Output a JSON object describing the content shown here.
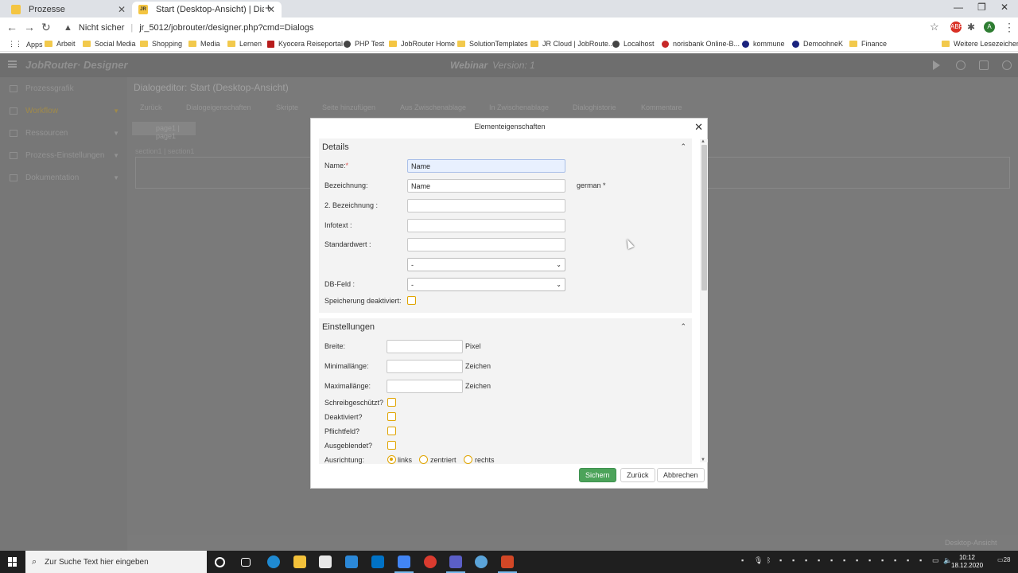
{
  "browser": {
    "tabs": [
      {
        "title": "Prozesse"
      },
      {
        "title": "Start (Desktop-Ansicht) | Dialoge"
      }
    ],
    "security_label": "Nicht sicher",
    "url": "jr_5012/jobrouter/designer.php?cmd=Dialogs",
    "bookmarks": [
      "Apps",
      "Arbeit",
      "Social Media",
      "Shopping",
      "Media",
      "Lernen",
      "Kyocera Reiseportal",
      "PHP Test",
      "JobRouter Home",
      "SolutionTemplates",
      "JR Cloud | JobRoute...",
      "Localhost",
      "norisbank Online-B...",
      "kommune",
      "DemoohneK",
      "Finance"
    ],
    "other_bookmarks": "Weitere Lesezeichen",
    "avatar_letter": "A"
  },
  "app": {
    "brand": "JobRouter",
    "brand_suffix": "Designer",
    "process_title": "Webinar",
    "version": "Version: 1",
    "sidebar": [
      "Prozessgrafik",
      "Workflow",
      "Ressourcen",
      "Prozess-Einstellungen",
      "Dokumentation"
    ],
    "content_title": "Dialogeditor: Start (Desktop-Ansicht)",
    "toolbar": [
      "Zurück",
      "Dialogeigenschaften",
      "Skripte",
      "Seite hinzufügen",
      "Aus Zwischenablage",
      "In Zwischenablage",
      "Dialoghistorie",
      "Kommentare"
    ],
    "page_tab": "page1 | page1",
    "section_label": "section1 | section1",
    "footer_view": "Desktop-Ansicht"
  },
  "modal": {
    "title": "Elementeigenschaften",
    "details": {
      "header": "Details",
      "name_label": "Name:",
      "name_value": "Name",
      "bezeichnung_label": "Bezeichnung:",
      "bezeichnung_value": "Name",
      "language": "german *",
      "bezeichnung2_label": "2. Bezeichnung :",
      "infotext_label": "Infotext :",
      "standardwert_label": "Standardwert :",
      "standardwert_select": "-",
      "dbfeld_label": "DB-Feld :",
      "dbfeld_value": "-",
      "speicherung_label": "Speicherung deaktiviert:"
    },
    "einstellungen": {
      "header": "Einstellungen",
      "breite_label": "Breite:",
      "breite_unit": "Pixel",
      "minlaenge_label": "Minimallänge:",
      "minlaenge_unit": "Zeichen",
      "maxlaenge_label": "Maximallänge:",
      "maxlaenge_unit": "Zeichen",
      "schreibgeschuetzt_label": "Schreibgeschützt?",
      "deaktiviert_label": "Deaktiviert?",
      "pflichtfeld_label": "Pflichtfeld?",
      "ausgeblendet_label": "Ausgeblendet?",
      "ausrichtung_label": "Ausrichtung:",
      "ausrichtung_options": [
        "links",
        "zentriert",
        "rechts"
      ],
      "ausrichtung_selected": "links"
    },
    "buttons": {
      "save": "Sichern",
      "back": "Zurück",
      "cancel": "Abbrechen"
    }
  },
  "taskbar": {
    "search_placeholder": "Zur Suche Text hier eingeben",
    "time": "10:12",
    "date": "18.12.2020",
    "notifications": "28"
  },
  "colors": {
    "primary_button": "#4ca35a",
    "checkbox_border": "#e0a400",
    "required_mark": "#d9534f"
  }
}
